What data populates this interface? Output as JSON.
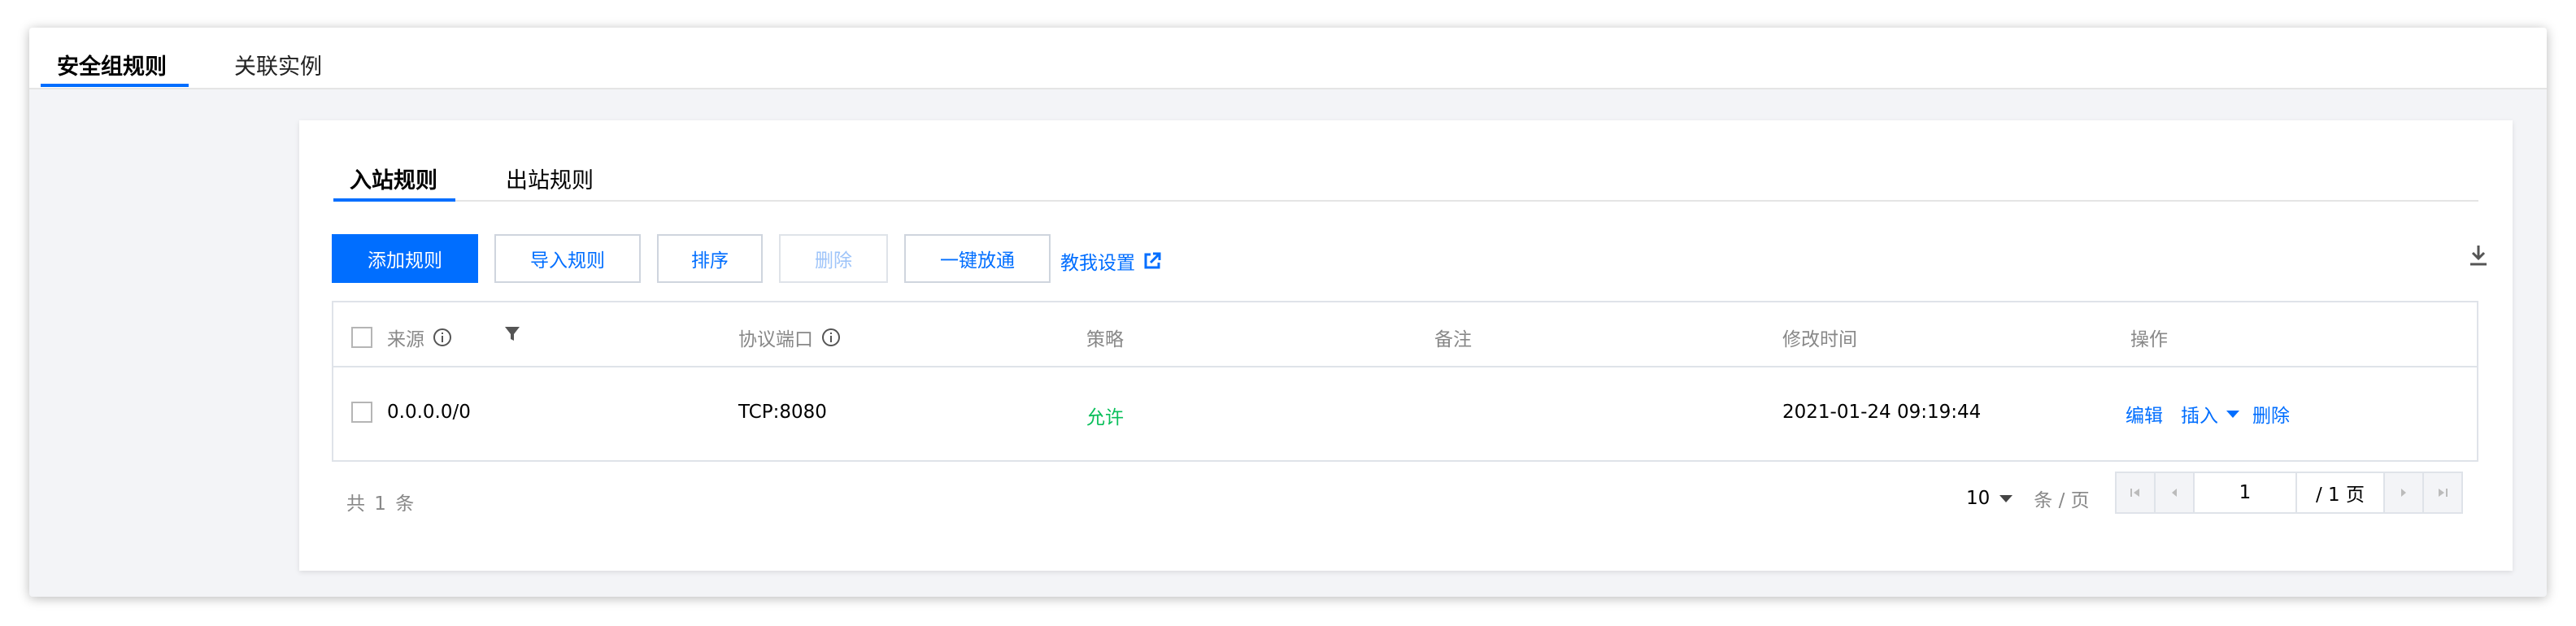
{
  "top_tabs": [
    {
      "label": "安全组规则",
      "active": true
    },
    {
      "label": "关联实例",
      "active": false
    }
  ],
  "sub_tabs": [
    {
      "label": "入站规则",
      "active": true
    },
    {
      "label": "出站规则",
      "active": false
    }
  ],
  "toolbar": {
    "add_label": "添加规则",
    "import_label": "导入规则",
    "sort_label": "排序",
    "delete_label": "删除",
    "allow_all_label": "一键放通",
    "guide_label": "教我设置",
    "download_icon": "download-icon"
  },
  "table": {
    "columns": [
      "来源",
      "协议端口",
      "策略",
      "备注",
      "修改时间",
      "操作"
    ],
    "rows": [
      {
        "source": "0.0.0.0/0",
        "port": "TCP:8080",
        "policy": "允许",
        "remark": "",
        "modified": "2021-01-24 09:19:44",
        "actions": {
          "edit": "编辑",
          "insert": "插入",
          "delete": "删除"
        }
      }
    ]
  },
  "footer": {
    "total_text": "共 1 条",
    "page_size": "10",
    "page_size_unit": "条 / 页",
    "current_page": "1",
    "total_pages": "/ 1 页"
  },
  "colors": {
    "accent": "#006eff",
    "allow": "#0abf5b"
  }
}
